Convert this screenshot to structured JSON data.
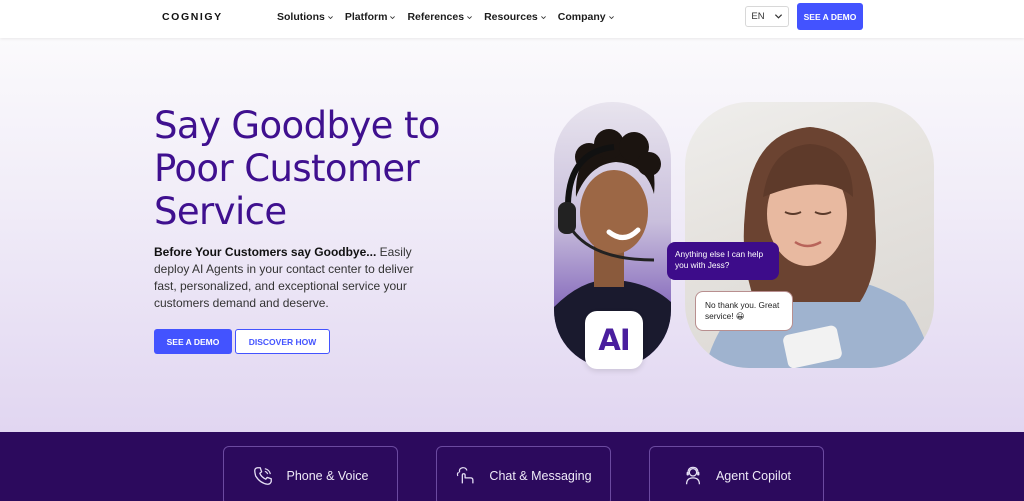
{
  "header": {
    "logo": "COGNIGY",
    "nav": [
      "Solutions",
      "Platform",
      "References",
      "Resources",
      "Company"
    ],
    "language": "EN",
    "cta": "SEE A DEMO"
  },
  "hero": {
    "title": "Say Goodbye to Poor Customer Service",
    "description_bold": "Before Your Customers say Goodbye...",
    "description_rest": " Easily deploy AI Agents in your contact center to deliver fast, personalized, and exceptional service your customers demand and deserve.",
    "primary_button": "SEE A DEMO",
    "secondary_button": "DISCOVER HOW",
    "ai_badge": "AI",
    "agent_message": "Anything else I can help you with Jess?",
    "customer_message": "No thank you. Great service! 😀"
  },
  "features": [
    {
      "label": "Phone & Voice",
      "icon": "phone-icon"
    },
    {
      "label": "Chat & Messaging",
      "icon": "chat-hand-icon"
    },
    {
      "label": "Agent Copilot",
      "icon": "agent-headset-icon"
    }
  ],
  "colors": {
    "brand_purple": "#3f108f",
    "accent_blue": "#4353ff",
    "band_purple": "#2c0a5d"
  }
}
